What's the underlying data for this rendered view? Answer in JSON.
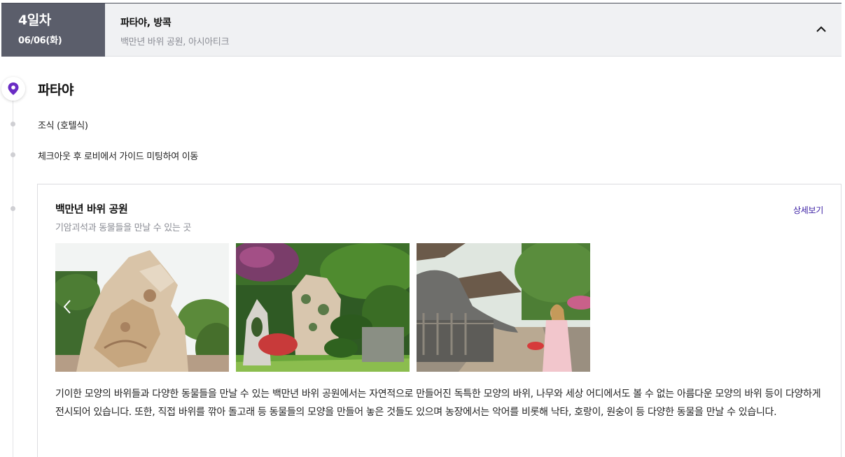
{
  "day": {
    "number_label": "4일차",
    "date_label": "06/06(화)",
    "city_label": "파타야, 방콕",
    "places_label": "백만년 바위 공원, 아시아티크"
  },
  "timeline": {
    "city": "파타야",
    "steps": [
      "조식 (호텔식)",
      "체크아웃 후 로비에서 가이드 미팅하여 이동"
    ]
  },
  "place": {
    "title": "백만년 바위 공원",
    "subtitle": "기암괴석과 동물들을 만날 수 있는 곳",
    "detail_link": "상세보기",
    "description": "기이한 모양의 바위들과 다양한 동물들을 만날 수 있는 백만년 바위 공원에서는 자연적으로 만들어진 독특한 모양의 바위, 나무와 세상 어디에서도 볼 수 없는 아름다운 모양의 바위 등이 다양하게 전시되어 있습니다. 또한, 직접 바위를 깎아 돌고래 등 동물들의 모양을 만들어 놓은 것들도 있으며 농장에서는 악어를 비롯해 낙타, 호랑이, 원숭이 등 다양한 동물을 만날 수 있습니다."
  },
  "colors": {
    "accent": "#6a2cc4",
    "badge_bg": "#5b5e6b",
    "link": "#3a1ea3"
  },
  "icons": [
    "location-pin-icon",
    "chevron-up-icon",
    "chevron-left-icon"
  ]
}
